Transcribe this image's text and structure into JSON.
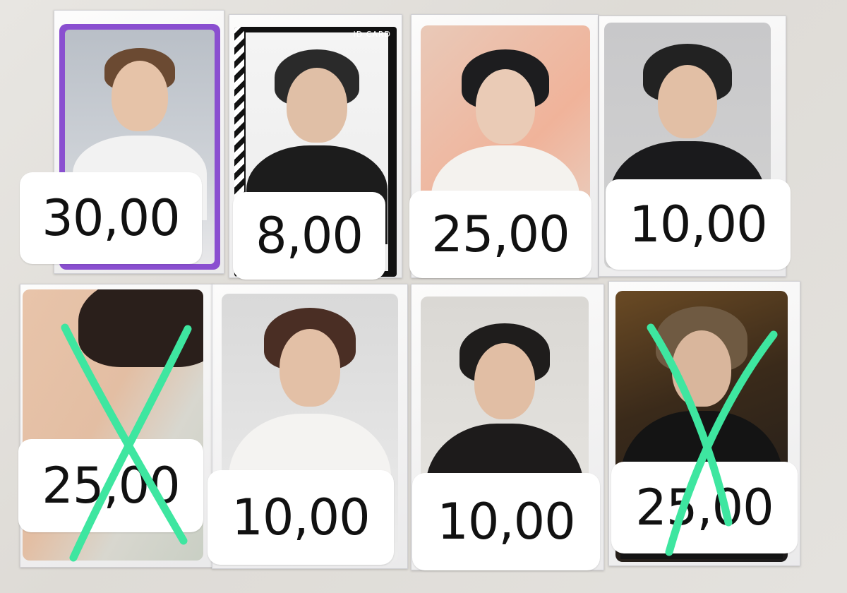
{
  "photocards": [
    {
      "price": "30,00",
      "crossed_out": false,
      "frame": "purple-border",
      "marking": ""
    },
    {
      "price": "8,00",
      "crossed_out": false,
      "frame": "id-card",
      "marking": "ID CARD"
    },
    {
      "price": "25,00",
      "crossed_out": false,
      "frame": "plain",
      "marking": ""
    },
    {
      "price": "10,00",
      "crossed_out": false,
      "frame": "plain",
      "marking": ""
    },
    {
      "price": "25,00",
      "crossed_out": true,
      "frame": "plain",
      "marking": ""
    },
    {
      "price": "10,00",
      "crossed_out": false,
      "frame": "plain",
      "marking": ""
    },
    {
      "price": "10,00",
      "crossed_out": false,
      "frame": "plain",
      "marking": ""
    },
    {
      "price": "25,00",
      "crossed_out": true,
      "frame": "plain",
      "marking": ""
    }
  ],
  "colors": {
    "cross_mark": "#3ee6a0",
    "purple_frame": "#8a4fd0",
    "price_tag_bg": "#ffffff",
    "price_text": "#111111"
  }
}
